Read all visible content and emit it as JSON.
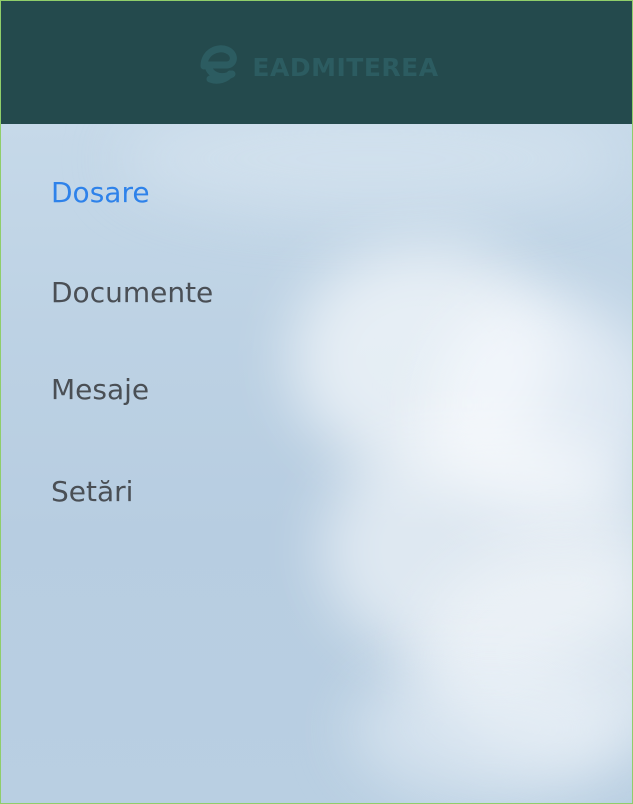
{
  "header": {
    "brand_text": "EADMITEREA",
    "logo_icon": "e-letter-icon",
    "bg_color": "#244a4d"
  },
  "sidebar": {
    "items": [
      {
        "label": "Dosare",
        "active": true
      },
      {
        "label": "Documente",
        "active": false
      },
      {
        "label": "Mesaje",
        "active": false
      },
      {
        "label": "Setări",
        "active": false
      }
    ]
  },
  "colors": {
    "active_link": "#2e82ea",
    "inactive_link": "#4a4f55",
    "border": "#8fce6a"
  }
}
